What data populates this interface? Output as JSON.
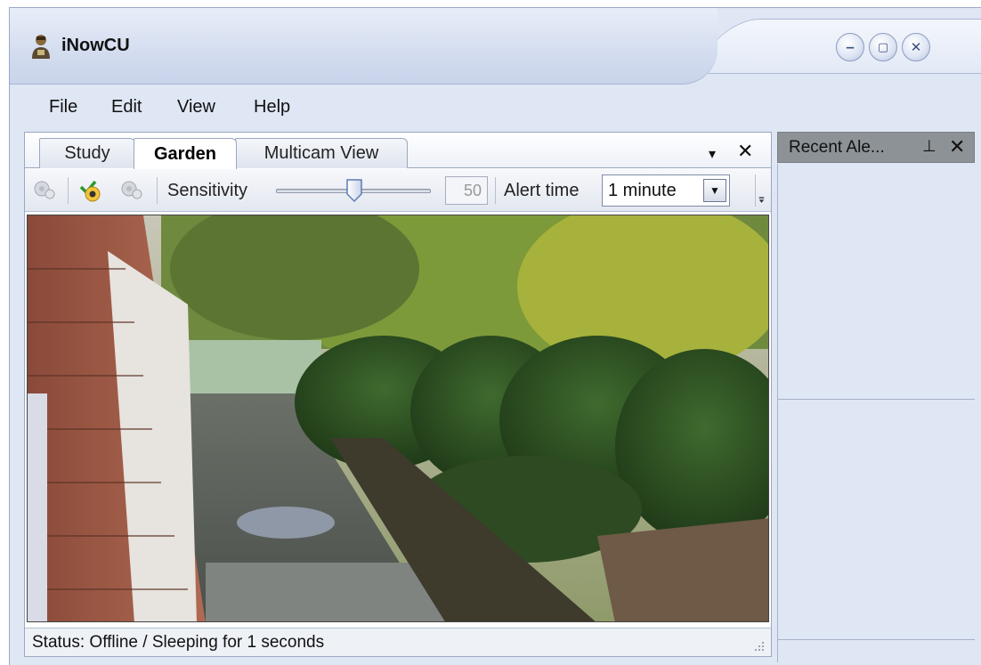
{
  "window": {
    "title": "iNowCU",
    "minimize_icon": "minimize-icon",
    "maximize_icon": "maximize-icon",
    "close_icon": "close-icon"
  },
  "menu": {
    "items": [
      {
        "label": "File"
      },
      {
        "label": "Edit"
      },
      {
        "label": "View"
      },
      {
        "label": "Help"
      }
    ]
  },
  "tabs": [
    {
      "label": "Study",
      "active": false
    },
    {
      "label": "Garden",
      "active": true
    },
    {
      "label": "Multicam View",
      "active": false
    }
  ],
  "tabstrip_controls": {
    "dropdown": "▾",
    "close": "✕"
  },
  "toolbar": {
    "sensitivity_label": "Sensitivity",
    "sensitivity_value": "50",
    "sensitivity_level": 0.5,
    "alert_time_label": "Alert time",
    "alert_time_value": "1 minute"
  },
  "status": {
    "text": "Status:  Offline / Sleeping for 1 seconds"
  },
  "side_panel": {
    "title": "Recent Ale...",
    "pin": "⊥",
    "close": "✕"
  },
  "colors": {
    "window_bg": "#dfe6f4",
    "side_header": "#8c9296",
    "accent": "#3b4f80"
  }
}
